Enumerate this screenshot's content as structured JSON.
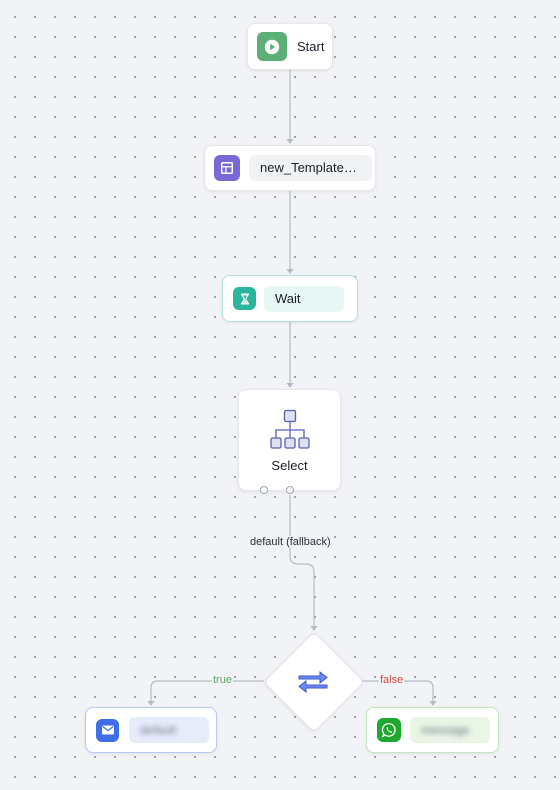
{
  "canvas": {
    "dot_color": "#8e929b",
    "background": "#f2f3f6",
    "edge_color": "#b6bac7"
  },
  "nodes": {
    "start": {
      "label": "Start",
      "icon": "play-icon",
      "color": "#5db075"
    },
    "template": {
      "label": "new_Template_...",
      "icon": "template-layout-icon",
      "color": "#7b67d8"
    },
    "wait": {
      "label": "Wait",
      "icon": "hourglass-icon",
      "color": "#2bb59d"
    },
    "select": {
      "label": "Select",
      "icon": "hierarchy-icon",
      "color": "#5a5fb0"
    },
    "condition": {
      "icon": "swap-arrows-icon",
      "color": "#3e57d0"
    },
    "email": {
      "label": "default",
      "icon": "mail-icon",
      "color": "#3f6ee8",
      "blurred": true
    },
    "whatsapp": {
      "label": "message",
      "icon": "whatsapp-icon",
      "color": "#1fa82e",
      "blurred": true
    }
  },
  "edges": {
    "fallback_label": "default (fallback)",
    "true_label": "true",
    "false_label": "false",
    "true_color": "#5aa868",
    "false_color": "#d14a42"
  }
}
